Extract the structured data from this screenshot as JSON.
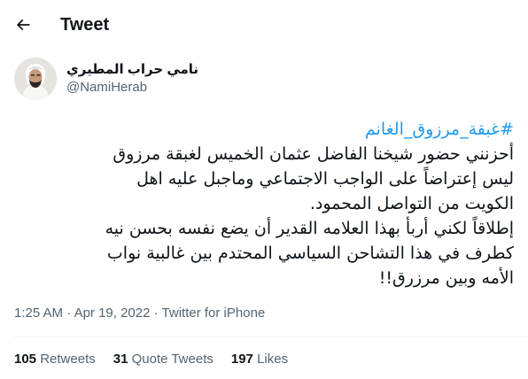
{
  "header": {
    "title": "Tweet",
    "back_icon": "arrow-left-icon"
  },
  "author": {
    "name": "نامي حراب المطيري",
    "handle": "@NamiHerab"
  },
  "tweet": {
    "hashtag": "#غبقة_مرزوق_الغانم",
    "lines": [
      "أحزنني حضور شيخنا الفاضل عثمان الخميس لغبقة مرزوق",
      "ليس إعتراضاً على الواجب الاجتماعي وماجبل عليه اهل",
      "الكويت من التواصل المحمود.",
      "إطلاقاً لكني أربأ بهذا العلامه القدير أن يضع نفسه بحسن نيه",
      "كطرف في هذا التشاحن السياسي المحتدم بين غالبية نواب",
      "الأمه وبين مرزرق!!"
    ]
  },
  "meta": {
    "time": "1:25 AM",
    "separator": "·",
    "date": "Apr 19, 2022",
    "source": "Twitter for iPhone"
  },
  "stats": {
    "retweets_count": "105",
    "retweets_label": "Retweets",
    "quotes_count": "31",
    "quotes_label": "Quote Tweets",
    "likes_count": "197",
    "likes_label": "Likes"
  },
  "colors": {
    "link": "#1d9bf0",
    "secondary_text": "#536471",
    "primary_text": "#0f1419",
    "divider": "#eff3f4"
  }
}
